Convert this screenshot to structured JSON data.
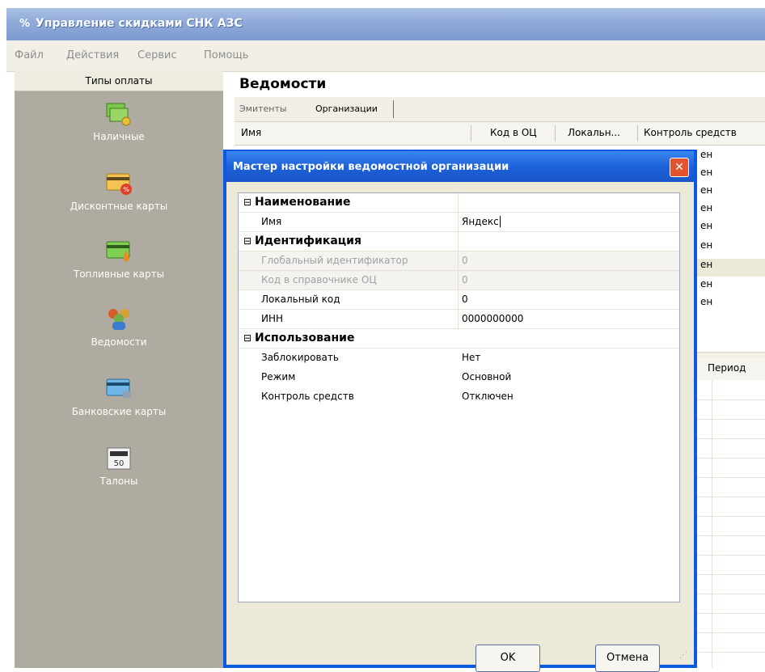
{
  "app": {
    "title": "Управление скидками СНК АЗС",
    "title_icon": "%"
  },
  "menu": [
    "Файл",
    "Действия",
    "Сервис",
    "Помощь"
  ],
  "sidebar": {
    "header": "Типы оплаты",
    "items": [
      {
        "label": "Наличные",
        "icon": "cash-icon"
      },
      {
        "label": "Дисконтные карты",
        "icon": "discount-card-icon"
      },
      {
        "label": "Топливные карты",
        "icon": "fuel-card-icon"
      },
      {
        "label": "Ведомости",
        "icon": "people-icon"
      },
      {
        "label": "Банковские карты",
        "icon": "bank-card-icon"
      },
      {
        "label": "Талоны",
        "icon": "coupon-icon"
      }
    ]
  },
  "main": {
    "title": "Ведомости",
    "tabs": [
      "Эмитенты",
      "Организации"
    ],
    "columns": [
      "Имя",
      "Код в ОЦ",
      "Локальн...",
      "Контроль средств"
    ],
    "row_fragments": [
      "ен",
      "ен",
      "ен",
      "ен",
      "ен",
      "ен",
      "ен",
      "ен",
      "ен"
    ],
    "second_header": "Период"
  },
  "dialog": {
    "title": "Мастер настройки ведомостной организации",
    "rows": [
      {
        "type": "cat",
        "name": "Наименование"
      },
      {
        "type": "prop",
        "name": "Имя",
        "value": "Яндекс"
      },
      {
        "type": "cat",
        "name": "Идентификация"
      },
      {
        "type": "prop",
        "name": "Глобальный идентификатор",
        "value": "0",
        "disabled": true
      },
      {
        "type": "prop",
        "name": "Код в справочнике ОЦ",
        "value": "0",
        "disabled": true
      },
      {
        "type": "prop",
        "name": "Локальный код",
        "value": "0"
      },
      {
        "type": "prop",
        "name": "ИНН",
        "value": "0000000000"
      },
      {
        "type": "cat",
        "name": "Использование"
      },
      {
        "type": "prop",
        "name": "Заблокировать",
        "value": "Нет"
      },
      {
        "type": "prop",
        "name": "Режим",
        "value": "Основной"
      },
      {
        "type": "prop",
        "name": "Контроль средств",
        "value": "Отключен"
      }
    ],
    "ok_label": "OK",
    "cancel_label": "Отмена"
  }
}
